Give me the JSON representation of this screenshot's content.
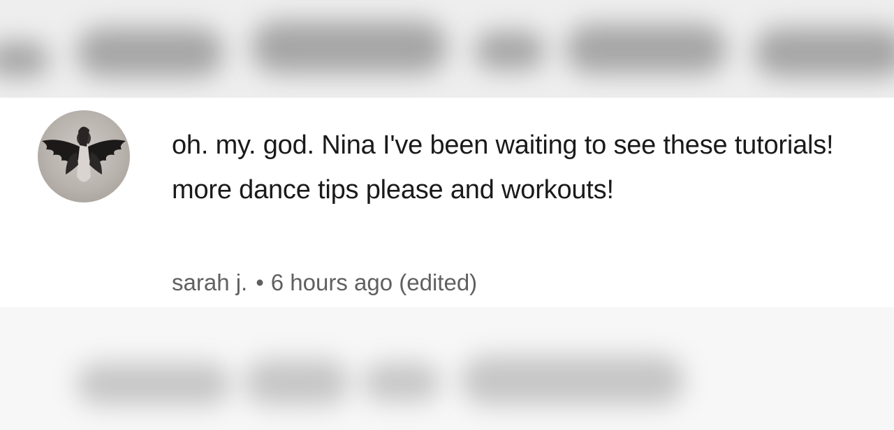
{
  "comment": {
    "avatar_icon": "angel-wings-avatar-icon",
    "text": "oh. my. god. Nina I've been waiting to see these tutorials! more dance tips please and workouts!",
    "author": "sarah j.",
    "separator": "•",
    "timestamp": "6 hours ago",
    "edited_label": "(edited)"
  },
  "colors": {
    "text": "#1a1a1a",
    "meta": "#606060",
    "blurred_background": "#eeeeee"
  }
}
